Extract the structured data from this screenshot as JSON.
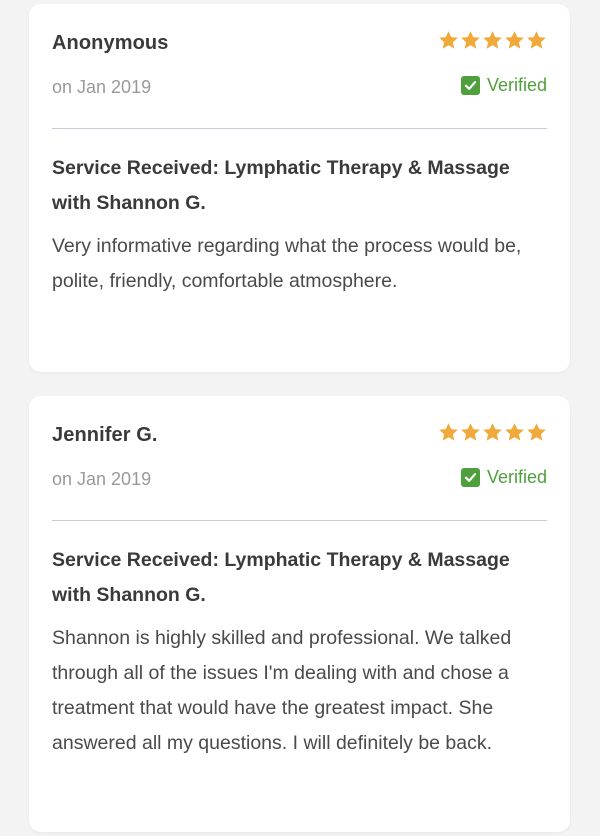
{
  "colors": {
    "star": "#f0a93b",
    "verified": "#4ea03c",
    "divider": "#c9ccd8"
  },
  "reviews": [
    {
      "name": "Anonymous",
      "date": "on Jan 2019",
      "rating": 5,
      "verified_label": "Verified",
      "service": "Service Received: Lymphatic Therapy & Massage with Shannon G.",
      "body": "Very informative regarding what the process would be, polite, friendly, comfortable atmosphere."
    },
    {
      "name": "Jennifer G.",
      "date": "on Jan 2019",
      "rating": 5,
      "verified_label": "Verified",
      "service": "Service Received: Lymphatic Therapy & Massage with Shannon G.",
      "body": "Shannon is highly skilled and professional. We talked through all of the issues I'm dealing with and chose a treatment that would have the greatest impact. She answered all my questions. I will definitely be back."
    }
  ]
}
